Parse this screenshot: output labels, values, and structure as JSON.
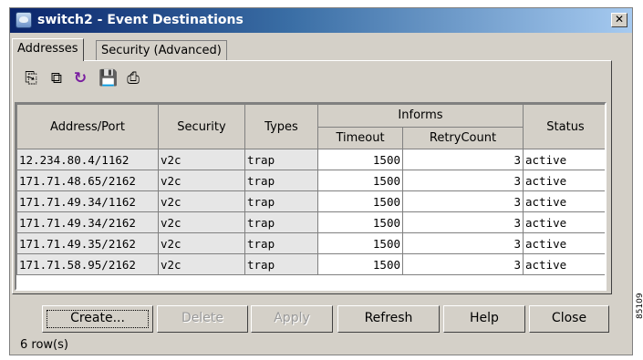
{
  "window": {
    "title": "switch2 - Event Destinations",
    "close_glyph": "✕"
  },
  "tabs": [
    {
      "label": "Addresses",
      "active": true
    },
    {
      "label": "Security (Advanced)",
      "active": false
    }
  ],
  "toolbar": [
    {
      "icon": "create-row-icon",
      "glyph": "⎘"
    },
    {
      "icon": "copy-row-icon",
      "glyph": "⧉"
    },
    {
      "icon": "refresh-icon",
      "glyph": "↻"
    },
    {
      "icon": "save-icon",
      "glyph": "💾"
    },
    {
      "icon": "print-icon",
      "glyph": "⎙"
    }
  ],
  "table": {
    "headers": {
      "address": "Address/Port",
      "security": "Security",
      "types": "Types",
      "informs": "Informs",
      "timeout": "Timeout",
      "retry": "RetryCount",
      "status": "Status"
    },
    "rows": [
      {
        "address": "12.234.80.4/1162",
        "security": "v2c",
        "types": "trap",
        "timeout": "1500",
        "retry": "3",
        "status": "active"
      },
      {
        "address": "171.71.48.65/2162",
        "security": "v2c",
        "types": "trap",
        "timeout": "1500",
        "retry": "3",
        "status": "active"
      },
      {
        "address": "171.71.49.34/1162",
        "security": "v2c",
        "types": "trap",
        "timeout": "1500",
        "retry": "3",
        "status": "active"
      },
      {
        "address": "171.71.49.34/2162",
        "security": "v2c",
        "types": "trap",
        "timeout": "1500",
        "retry": "3",
        "status": "active"
      },
      {
        "address": "171.71.49.35/2162",
        "security": "v2c",
        "types": "trap",
        "timeout": "1500",
        "retry": "3",
        "status": "active"
      },
      {
        "address": "171.71.58.95/2162",
        "security": "v2c",
        "types": "trap",
        "timeout": "1500",
        "retry": "3",
        "status": "active"
      }
    ]
  },
  "buttons": {
    "create": "Create...",
    "delete": "Delete",
    "apply": "Apply",
    "refresh": "Refresh",
    "help": "Help",
    "close": "Close"
  },
  "status": {
    "row_count": "6 row(s)"
  },
  "figure_id": "85109"
}
